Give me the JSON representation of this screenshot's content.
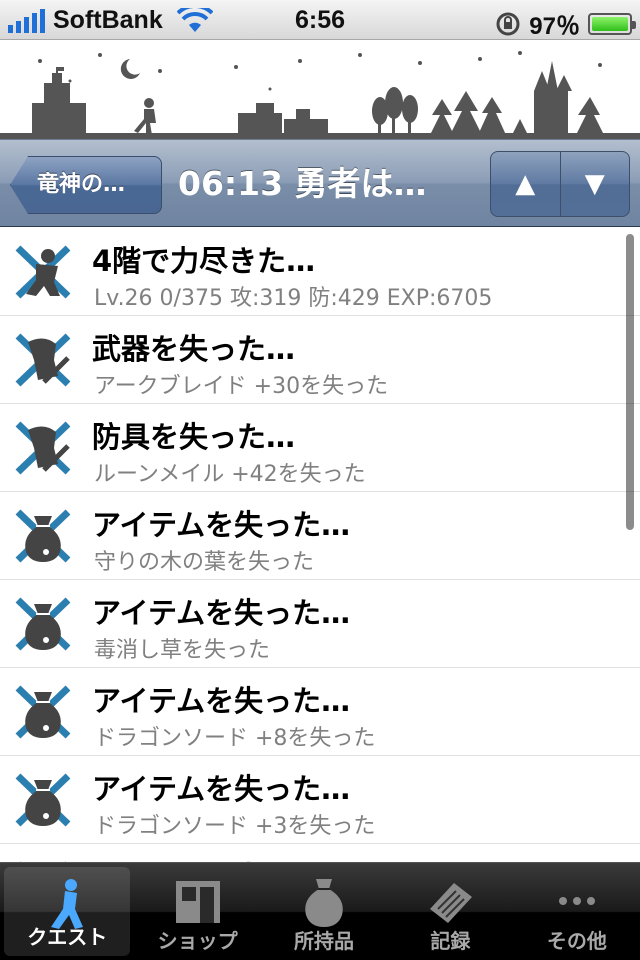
{
  "status_bar": {
    "carrier": "SoftBank",
    "time": "6:56",
    "battery": "97％"
  },
  "nav": {
    "back_label": "竜神の…",
    "title": "06:13 勇者は…",
    "up_glyph": "▲",
    "down_glyph": "▼"
  },
  "list": {
    "items": [
      {
        "icon": "fallen-hero-icon",
        "title": "4階で力尽きた…",
        "subtitle": "Lv.26 0/375 攻:319 防:429 EXP:6705"
      },
      {
        "icon": "lost-weapon-icon",
        "title": "武器を失った…",
        "subtitle": "アークブレイド +30を失った"
      },
      {
        "icon": "lost-armor-icon",
        "title": "防具を失った…",
        "subtitle": "ルーンメイル +42を失った"
      },
      {
        "icon": "lost-item-icon",
        "title": "アイテムを失った…",
        "subtitle": "守りの木の葉を失った"
      },
      {
        "icon": "lost-item-icon",
        "title": "アイテムを失った…",
        "subtitle": "毒消し草を失った"
      },
      {
        "icon": "lost-item-icon",
        "title": "アイテムを失った…",
        "subtitle": "ドラゴンソード +8を失った"
      },
      {
        "icon": "lost-item-icon",
        "title": "アイテムを失った…",
        "subtitle": "ドラゴンソード +3を失った"
      },
      {
        "icon": "lost-item-icon",
        "title": "アイテムを失った…",
        "subtitle": ""
      }
    ]
  },
  "tabbar": {
    "tabs": [
      {
        "label": "クエスト",
        "icon": "hero-icon",
        "active": true
      },
      {
        "label": "ショップ",
        "icon": "shop-icon",
        "active": false
      },
      {
        "label": "所持品",
        "icon": "bag-icon",
        "active": false
      },
      {
        "label": "記録",
        "icon": "notes-icon",
        "active": false
      },
      {
        "label": "その他",
        "icon": "more-icon",
        "active": false
      }
    ]
  },
  "colors": {
    "accent_blue": "#2a7fb0",
    "navbar": "#7a8ea9",
    "subtitle_gray": "#808080"
  }
}
